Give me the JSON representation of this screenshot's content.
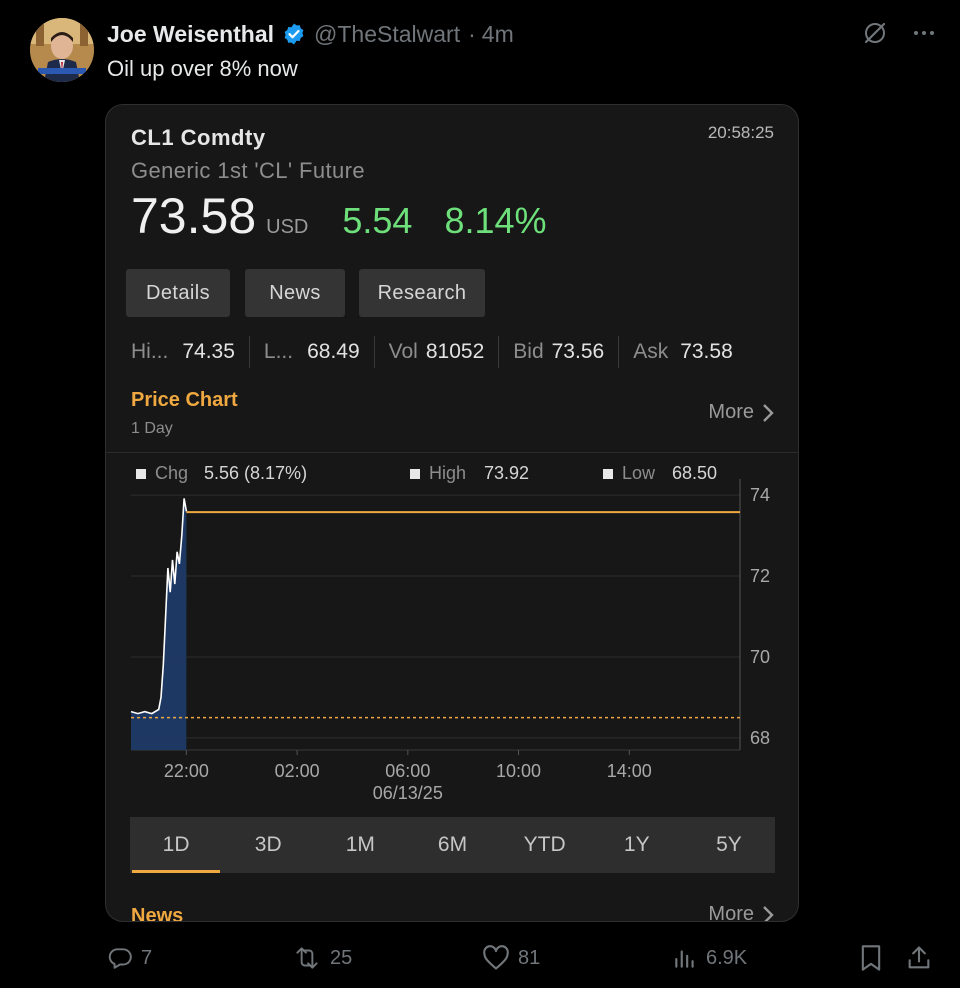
{
  "tweet": {
    "author_name": "Joe Weisenthal",
    "handle": "@TheStalwart",
    "separator": "·",
    "age": "4m",
    "text": "Oil up over 8% now"
  },
  "card": {
    "ticker": "CL1 Comdty",
    "time": "20:58:25",
    "description": "Generic 1st 'CL' Future",
    "price": "73.58",
    "currency": "USD",
    "change": "5.54",
    "change_pct": "8.14%",
    "buttons": {
      "details": "Details",
      "news": "News",
      "research": "Research"
    },
    "stats": {
      "hi_label": "Hi...",
      "hi_value": "74.35",
      "lo_label": "L...",
      "lo_value": "68.49",
      "vol_label": "Vol",
      "vol_value": "81052",
      "bid_label": "Bid",
      "bid_value": "73.56",
      "ask_label": "Ask",
      "ask_value": "73.58"
    },
    "price_chart_title": "Price Chart",
    "price_chart_period": "1 Day",
    "more_label": "More",
    "news_title": "News",
    "tabs": [
      "1D",
      "3D",
      "1M",
      "6M",
      "YTD",
      "1Y",
      "5Y"
    ],
    "active_tab": "1D"
  },
  "chart_data": {
    "type": "area",
    "legend": [
      {
        "label": "Chg",
        "value": "5.56 (8.17%)"
      },
      {
        "label": "High",
        "value": "73.92"
      },
      {
        "label": "Low",
        "value": "68.50"
      }
    ],
    "x_ticks": [
      "22:00",
      "02:00",
      "06:00",
      "10:00",
      "14:00"
    ],
    "date_label": "06/13/25",
    "y_ticks": [
      "74",
      "72",
      "70",
      "68"
    ],
    "ylim": [
      67.7,
      74.3
    ],
    "x": [
      "20:00",
      "20:15",
      "20:30",
      "20:45",
      "21:00",
      "21:05",
      "21:10",
      "21:15",
      "21:20",
      "21:25",
      "21:30",
      "21:35",
      "21:40",
      "21:45",
      "21:50",
      "21:55",
      "22:00"
    ],
    "values": [
      68.65,
      68.6,
      68.65,
      68.6,
      68.7,
      69.0,
      69.8,
      71.0,
      72.2,
      71.6,
      72.4,
      71.8,
      72.6,
      72.3,
      73.0,
      73.92,
      73.6
    ],
    "last_close": 73.58,
    "low_line": 68.5,
    "colors": {
      "line": "#ffffff",
      "fill": "#1d3a66",
      "close_line": "#f0a840",
      "low_line": "#f0a840"
    }
  },
  "actions": {
    "replies": "7",
    "reposts": "25",
    "likes": "81",
    "views": "6.9K"
  }
}
